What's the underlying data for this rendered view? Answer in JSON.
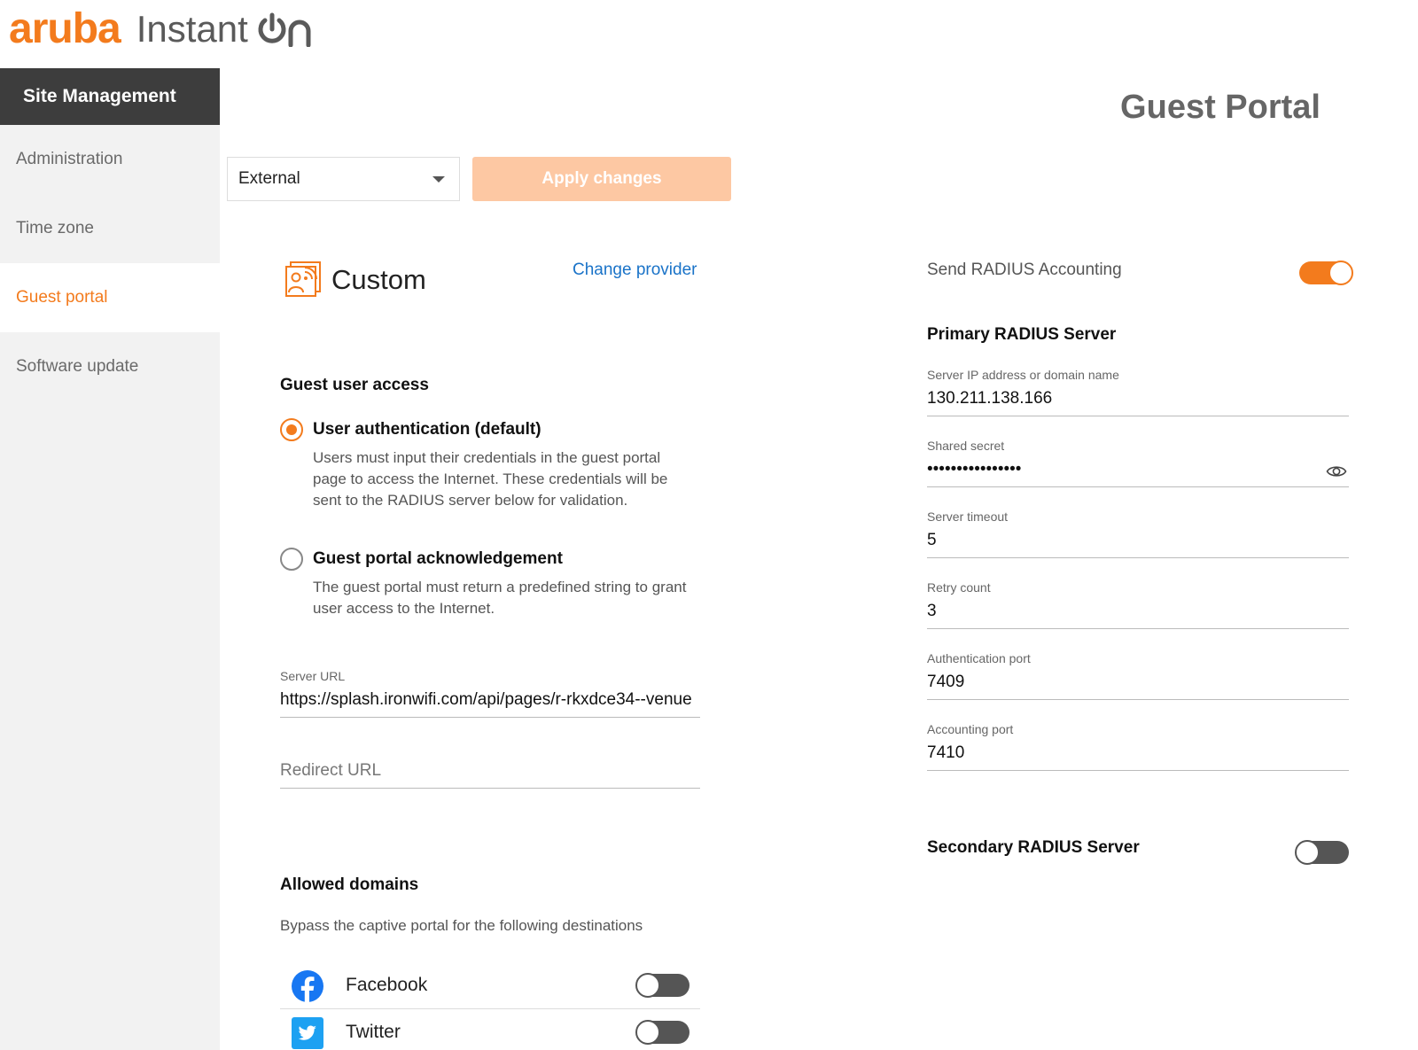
{
  "brand": {
    "logo_text": "aruba",
    "product_text": "Instant",
    "accent_color": "#f37b1d"
  },
  "sidebar": {
    "title": "Site Management",
    "items": [
      {
        "label": "Administration"
      },
      {
        "label": "Time zone"
      },
      {
        "label": "Guest portal",
        "active": true
      },
      {
        "label": "Software update"
      }
    ]
  },
  "page": {
    "title": "Guest Portal"
  },
  "toolbar": {
    "mode_value": "External",
    "apply_label": "Apply changes"
  },
  "provider": {
    "name": "Custom",
    "change_label": "Change provider",
    "icon": "wifi-portal-icon"
  },
  "guest_access": {
    "heading": "Guest user access",
    "options": [
      {
        "label": "User authentication (default)",
        "description": "Users must input their credentials in the guest portal page to access the Internet. These credentials will be sent to the RADIUS server below for validation.",
        "selected": true
      },
      {
        "label": "Guest portal acknowledgement",
        "description": "The guest portal must return a predefined string to grant user access to the Internet.",
        "selected": false
      }
    ]
  },
  "server_url": {
    "label": "Server URL",
    "value": "https://splash.ironwifi.com/api/pages/r-rkxdce34--venue"
  },
  "redirect_url": {
    "placeholder": "Redirect URL"
  },
  "allowed_domains": {
    "heading": "Allowed domains",
    "description": "Bypass the captive portal for the following destinations",
    "items": [
      {
        "name": "Facebook",
        "icon": "facebook-icon",
        "enabled": false
      },
      {
        "name": "Twitter",
        "icon": "twitter-icon",
        "enabled": false
      }
    ]
  },
  "radius": {
    "accounting_label": "Send RADIUS Accounting",
    "accounting_enabled": true,
    "primary_heading": "Primary RADIUS Server",
    "fields": {
      "server_ip": {
        "label": "Server IP address or domain name",
        "value": "130.211.138.166"
      },
      "shared_secret": {
        "label": "Shared secret",
        "value": "••••••••••••••••"
      },
      "timeout": {
        "label": "Server timeout",
        "value": "5"
      },
      "retry": {
        "label": "Retry count",
        "value": "3"
      },
      "auth_port": {
        "label": "Authentication port",
        "value": "7409"
      },
      "acct_port": {
        "label": "Accounting port",
        "value": "7410"
      }
    },
    "secondary_heading": "Secondary RADIUS Server",
    "secondary_enabled": false
  }
}
